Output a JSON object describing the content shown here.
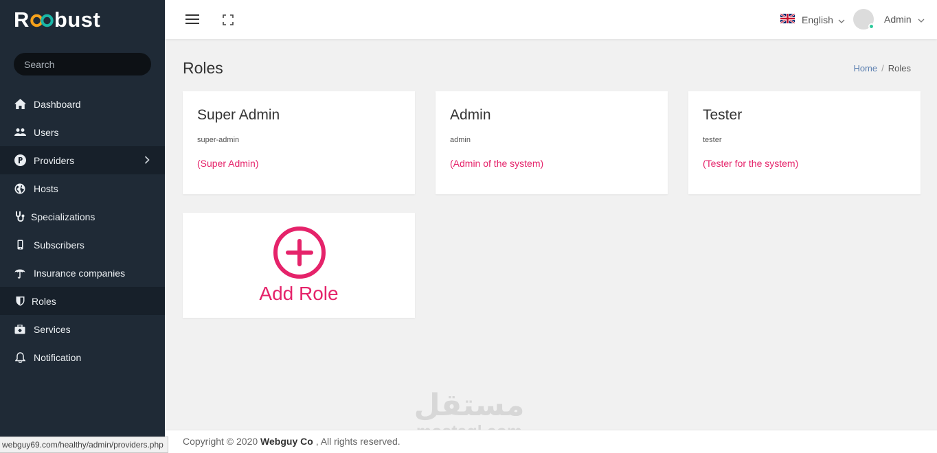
{
  "brand": {
    "name_left": "R",
    "name_right": "bust"
  },
  "search": {
    "placeholder": "Search"
  },
  "sidebar": {
    "items": [
      {
        "label": "Dashboard",
        "icon": "home-icon"
      },
      {
        "label": "Users",
        "icon": "users-icon"
      },
      {
        "label": "Providers",
        "icon": "p-circle-icon"
      },
      {
        "label": "Hosts",
        "icon": "globe-icon"
      },
      {
        "label": "Specializations",
        "icon": "stethoscope-icon"
      },
      {
        "label": "Subscribers",
        "icon": "mobile-icon"
      },
      {
        "label": "Insurance companies",
        "icon": "umbrella-icon"
      },
      {
        "label": "Roles",
        "icon": "shield-icon"
      },
      {
        "label": "Services",
        "icon": "medkit-icon"
      },
      {
        "label": "Notification",
        "icon": "bell-icon"
      }
    ]
  },
  "topbar": {
    "language": "English",
    "user": "Admin"
  },
  "page": {
    "title": "Roles"
  },
  "breadcrumb": {
    "home": "Home",
    "sep": "/",
    "current": "Roles"
  },
  "roles": [
    {
      "name": "Super Admin",
      "slug": "super-admin",
      "description": "(Super Admin)"
    },
    {
      "name": "Admin",
      "slug": "admin",
      "description": "(Admin of the system)"
    },
    {
      "name": "Tester",
      "slug": "tester",
      "description": "(Tester for the system)"
    }
  ],
  "add_role": {
    "label": "Add Role"
  },
  "footer": {
    "prefix": "Copyright © 2020",
    "company": "Webguy Co",
    "suffix": ", All rights reserved."
  },
  "status_url": "webguy69.com/healthy/admin/providers.php",
  "watermark": {
    "arabic": "مستقل",
    "latin": "mostaql.com"
  },
  "colors": {
    "sidebar": "#1f2a36",
    "accent": "#e5236a",
    "online": "#2ec99b"
  }
}
